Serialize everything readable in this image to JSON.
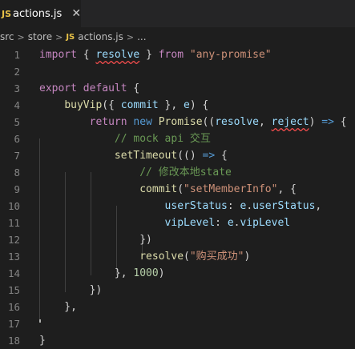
{
  "tab": {
    "badge": "JS",
    "title": "actions.js",
    "close": "✕"
  },
  "breadcrumb": {
    "parts": [
      "src",
      "store"
    ],
    "file_badge": "JS",
    "file": "actions.js",
    "ellipsis": "..."
  },
  "lines": [
    {
      "n": "1",
      "tokens": [
        [
          "kw",
          "import"
        ],
        [
          "pl",
          " { "
        ],
        [
          "var squig",
          "resolve"
        ],
        [
          "pl",
          " } "
        ],
        [
          "kw",
          "from"
        ],
        [
          "pl",
          " "
        ],
        [
          "str",
          "\"any-promise\""
        ]
      ]
    },
    {
      "n": "2",
      "tokens": []
    },
    {
      "n": "3",
      "tokens": [
        [
          "kw",
          "export"
        ],
        [
          "pl",
          " "
        ],
        [
          "kw",
          "default"
        ],
        [
          "pl",
          " {"
        ]
      ]
    },
    {
      "n": "4",
      "tokens": [
        [
          "pl",
          "    "
        ],
        [
          "fn",
          "buyVip"
        ],
        [
          "pl",
          "({ "
        ],
        [
          "var",
          "commit"
        ],
        [
          "pl",
          " }, "
        ],
        [
          "var",
          "e"
        ],
        [
          "pl",
          ") {"
        ]
      ]
    },
    {
      "n": "5",
      "tokens": [
        [
          "pl",
          "        "
        ],
        [
          "kw",
          "return"
        ],
        [
          "pl",
          " "
        ],
        [
          "kb",
          "new"
        ],
        [
          "pl",
          " "
        ],
        [
          "fn",
          "Promise"
        ],
        [
          "pl",
          "(("
        ],
        [
          "var",
          "resolve"
        ],
        [
          "pl",
          ", "
        ],
        [
          "var squig",
          "reject"
        ],
        [
          "pl",
          ") "
        ],
        [
          "kb",
          "=>"
        ],
        [
          "pl",
          " {"
        ]
      ]
    },
    {
      "n": "6",
      "tokens": [
        [
          "pl",
          "            "
        ],
        [
          "cm",
          "// mock api 交互"
        ]
      ]
    },
    {
      "n": "7",
      "tokens": [
        [
          "pl",
          "            "
        ],
        [
          "fn",
          "setTimeout"
        ],
        [
          "pl",
          "(() "
        ],
        [
          "kb",
          "=>"
        ],
        [
          "pl",
          " {"
        ]
      ]
    },
    {
      "n": "8",
      "tokens": [
        [
          "pl",
          "                "
        ],
        [
          "cm",
          "// 修改本地state"
        ]
      ]
    },
    {
      "n": "9",
      "tokens": [
        [
          "pl",
          "                "
        ],
        [
          "fn",
          "commit"
        ],
        [
          "pl",
          "("
        ],
        [
          "str",
          "\"setMemberInfo\""
        ],
        [
          "pl",
          ", {"
        ]
      ]
    },
    {
      "n": "10",
      "tokens": [
        [
          "pl",
          "                    "
        ],
        [
          "var",
          "userStatus"
        ],
        [
          "pl",
          ": "
        ],
        [
          "var",
          "e"
        ],
        [
          "pl",
          "."
        ],
        [
          "var",
          "userStatus"
        ],
        [
          "pl",
          ","
        ]
      ]
    },
    {
      "n": "11",
      "tokens": [
        [
          "pl",
          "                    "
        ],
        [
          "var",
          "vipLevel"
        ],
        [
          "pl",
          ": "
        ],
        [
          "var",
          "e"
        ],
        [
          "pl",
          "."
        ],
        [
          "var",
          "vipLevel"
        ]
      ]
    },
    {
      "n": "12",
      "tokens": [
        [
          "pl",
          "                })"
        ]
      ]
    },
    {
      "n": "13",
      "tokens": [
        [
          "pl",
          "                "
        ],
        [
          "fn",
          "resolve"
        ],
        [
          "pl",
          "("
        ],
        [
          "str",
          "\"购买成功\""
        ],
        [
          "pl",
          ")"
        ]
      ]
    },
    {
      "n": "14",
      "tokens": [
        [
          "pl",
          "            }, "
        ],
        [
          "num",
          "1000"
        ],
        [
          "pl",
          ")"
        ]
      ]
    },
    {
      "n": "15",
      "tokens": [
        [
          "pl",
          "        })"
        ]
      ]
    },
    {
      "n": "16",
      "tokens": [
        [
          "pl",
          "    },"
        ]
      ]
    },
    {
      "n": "17",
      "tokens": []
    },
    {
      "n": "18",
      "tokens": [
        [
          "pl",
          "}"
        ]
      ]
    }
  ]
}
